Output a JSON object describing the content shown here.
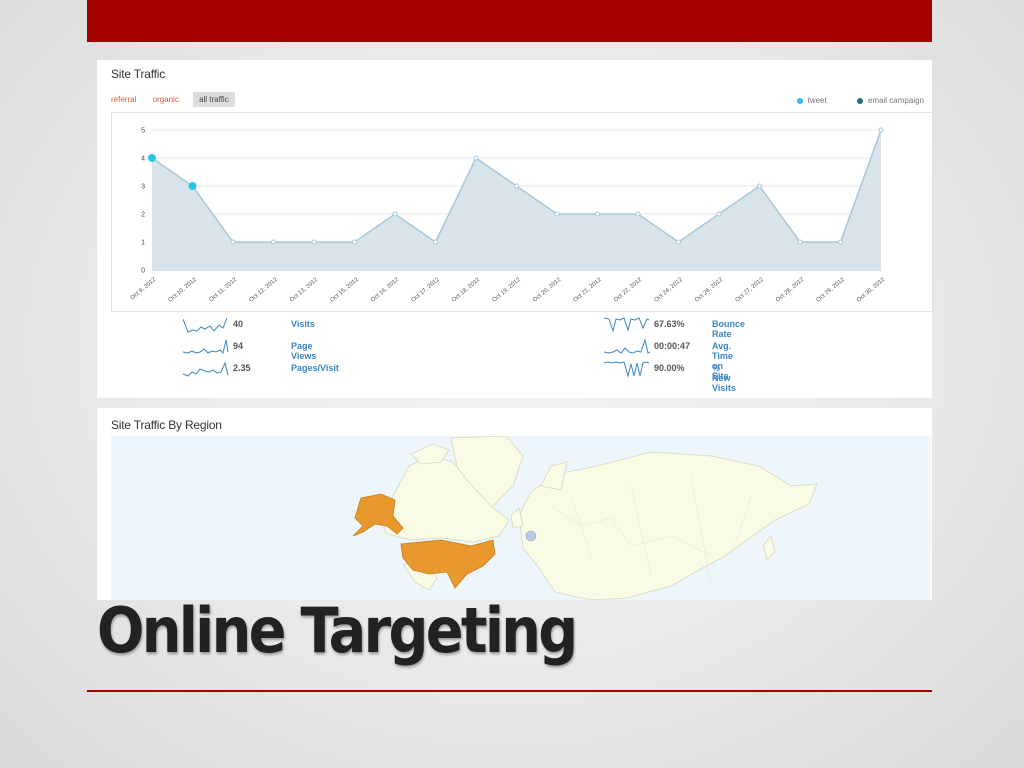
{
  "slide": {
    "title": "Online Targeting"
  },
  "traffic": {
    "title": "Site Traffic",
    "filters": [
      {
        "label": "referral",
        "active": false
      },
      {
        "label": "organic",
        "active": false
      },
      {
        "label": "all traffic",
        "active": true
      }
    ],
    "legend": [
      {
        "label": "tweet",
        "color": "#29c4ee"
      },
      {
        "label": "email campaign",
        "color": "#1f6f85"
      }
    ]
  },
  "chart_data": {
    "type": "area",
    "categories": [
      "Oct 9, 2012",
      "Oct 10, 2012",
      "Oct 11, 2012",
      "Oct 12, 2012",
      "Oct 13, 2012",
      "Oct 15, 2012",
      "Oct 16, 2012",
      "Oct 17, 2012",
      "Oct 18, 2012",
      "Oct 19, 2012",
      "Oct 20, 2012",
      "Oct 21, 2012",
      "Oct 22, 2012",
      "Oct 24, 2012",
      "Oct 26, 2012",
      "Oct 27, 2012",
      "Oct 28, 2012",
      "Oct 29, 2012",
      "Oct 30, 2012"
    ],
    "values": [
      4,
      3,
      1,
      1,
      1,
      1,
      2,
      1,
      4,
      3,
      2,
      2,
      2,
      1,
      2,
      3,
      1,
      1,
      5
    ],
    "yticks": [
      "0",
      "1",
      "2",
      "3",
      "4",
      "5"
    ],
    "ylim": [
      0,
      5
    ],
    "highlight_points": [
      {
        "index": 0,
        "series": "tweet"
      },
      {
        "index": 1,
        "series": "tweet"
      }
    ],
    "line_color": "#a7c8da",
    "fill_color": "#d9e4ea",
    "highlight_color": "#29c4ee"
  },
  "metrics": {
    "left": [
      {
        "value": "40",
        "label": "Visits"
      },
      {
        "value": "94",
        "label": "Page Views"
      },
      {
        "value": "2.35",
        "label": "Pages/Visit"
      }
    ],
    "right": [
      {
        "value": "67.63%",
        "label": "Bounce Rate"
      },
      {
        "value": "00:00:47",
        "label": "Avg. Time on Site"
      },
      {
        "value": "90.00%",
        "label": "% New Visits"
      }
    ]
  },
  "region": {
    "title": "Site Traffic By Region",
    "highlighted_regions": [
      "Alaska",
      "United States"
    ],
    "highlight_color": "#e8982c",
    "land_color": "#fafbe4",
    "water_color": "#eef5fb"
  },
  "colors": {
    "brand_red": "#a40000",
    "link_blue": "#3b86c6"
  }
}
